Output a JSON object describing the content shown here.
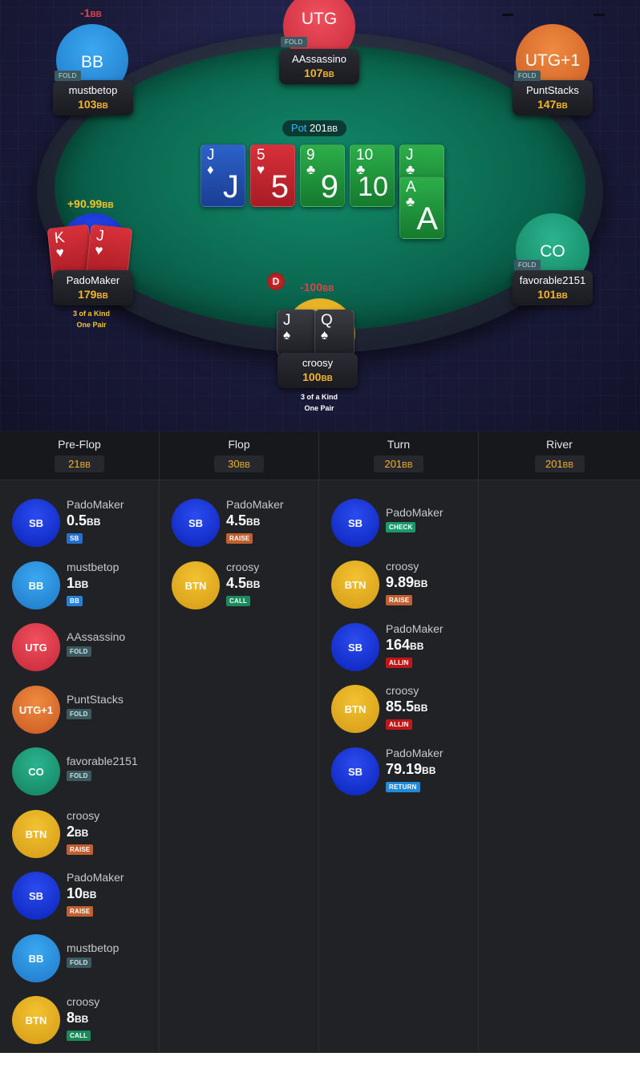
{
  "unit": "BB",
  "seats": {
    "utg": {
      "position": "UTG",
      "name": "AAssassino",
      "stack": "107",
      "status": "FOLD"
    },
    "bb": {
      "position": "BB",
      "name": "mustbetop",
      "stack": "103",
      "status": "FOLD",
      "delta": "-1"
    },
    "utg1": {
      "position": "UTG+1",
      "name": "PuntStacks",
      "stack": "147",
      "status": "FOLD"
    },
    "sb": {
      "name": "PadoMaker",
      "stack": "179",
      "delta": "+90.99",
      "hand_lines": [
        "3 of a Kind",
        "One Pair"
      ],
      "hole_cards": [
        {
          "rank": "K",
          "suit": "♥"
        },
        {
          "rank": "J",
          "suit": "♥"
        }
      ]
    },
    "co": {
      "position": "CO",
      "name": "favorable2151",
      "stack": "101",
      "status": "FOLD"
    },
    "btn": {
      "name": "croosy",
      "stack": "100",
      "delta": "-100",
      "hand_lines": [
        "3 of a Kind",
        "One Pair"
      ],
      "hole_cards": [
        {
          "rank": "J",
          "suit": "♠"
        },
        {
          "rank": "Q",
          "suit": "♠"
        }
      ]
    }
  },
  "pot": {
    "label": "Pot",
    "value": "201"
  },
  "dealer_button": "D",
  "board": [
    {
      "rank": "J",
      "suit": "♦",
      "color": "#2c62c8"
    },
    {
      "rank": "5",
      "suit": "♥",
      "color": "#d8303a"
    },
    {
      "rank": "9",
      "suit": "♣",
      "color": "#2cae4a"
    },
    {
      "rank": "10",
      "suit": "♣",
      "color": "#2cae4a"
    },
    {
      "rank": "J",
      "suit": "♣",
      "color": "#2cae4a"
    },
    {
      "rank": "A",
      "suit": "♣",
      "color": "#2cae4a"
    }
  ],
  "streets": [
    {
      "name": "Pre-Flop",
      "pot": "21",
      "actions": [
        {
          "pos": "SB",
          "player": "PadoMaker",
          "amount": "0.5",
          "action": "SB"
        },
        {
          "pos": "BB",
          "player": "mustbetop",
          "amount": "1",
          "action": "BB"
        },
        {
          "pos": "UTG",
          "player": "AAssassino",
          "amount": "",
          "action": "FOLD"
        },
        {
          "pos": "UTG+1",
          "player": "PuntStacks",
          "amount": "",
          "action": "FOLD"
        },
        {
          "pos": "CO",
          "player": "favorable2151",
          "amount": "",
          "action": "FOLD"
        },
        {
          "pos": "BTN",
          "player": "croosy",
          "amount": "2",
          "action": "RAISE"
        },
        {
          "pos": "SB",
          "player": "PadoMaker",
          "amount": "10",
          "action": "RAISE"
        },
        {
          "pos": "BB",
          "player": "mustbetop",
          "amount": "",
          "action": "FOLD"
        },
        {
          "pos": "BTN",
          "player": "croosy",
          "amount": "8",
          "action": "CALL"
        }
      ]
    },
    {
      "name": "Flop",
      "pot": "30",
      "actions": [
        {
          "pos": "SB",
          "player": "PadoMaker",
          "amount": "4.5",
          "action": "RAISE"
        },
        {
          "pos": "BTN",
          "player": "croosy",
          "amount": "4.5",
          "action": "CALL"
        }
      ]
    },
    {
      "name": "Turn",
      "pot": "201",
      "actions": [
        {
          "pos": "SB",
          "player": "PadoMaker",
          "amount": "",
          "action": "CHECK"
        },
        {
          "pos": "BTN",
          "player": "croosy",
          "amount": "9.89",
          "action": "RAISE"
        },
        {
          "pos": "SB",
          "player": "PadoMaker",
          "amount": "164",
          "action": "ALLIN"
        },
        {
          "pos": "BTN",
          "player": "croosy",
          "amount": "85.5",
          "action": "ALLIN"
        },
        {
          "pos": "SB",
          "player": "PadoMaker",
          "amount": "79.19",
          "action": "RETURN"
        }
      ]
    },
    {
      "name": "River",
      "pot": "201",
      "actions": []
    }
  ]
}
